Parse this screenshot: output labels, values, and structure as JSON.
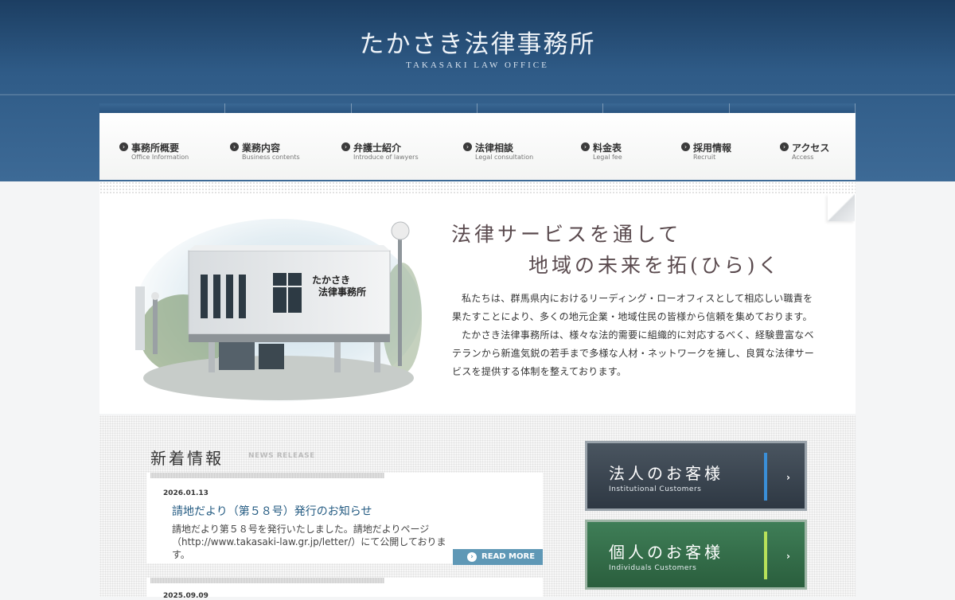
{
  "header": {
    "logo_jp": "たかさき法律事務所",
    "logo_en": "TAKASAKI LAW OFFICE"
  },
  "nav": [
    {
      "label": "事務所概要",
      "sub": "Office Information"
    },
    {
      "label": "業務内容",
      "sub": "Business contents"
    },
    {
      "label": "弁護士紹介",
      "sub": "Introduce of lawyers"
    },
    {
      "label": "法律相談",
      "sub": "Legal consultation"
    },
    {
      "label": "料金表",
      "sub": "Legal fee"
    },
    {
      "label": "採用情報",
      "sub": "Recruit"
    },
    {
      "label": "アクセス",
      "sub": "Access"
    }
  ],
  "hero": {
    "title_line1": "法律サービスを通して",
    "title_line2": "地域の未来を拓(ひら)く",
    "paragraph1": "私たちは、群馬県内におけるリーディング・ローオフィスとして相応しい職責を果たすことにより、多くの地元企業・地域住民の皆様から信頼を集めております。",
    "paragraph2": "たかさき法律事務所は、様々な法的需要に組織的に対応するべく、経験豊富なベテランから新進気鋭の若手まで多様な人材・ネットワークを擁し、良質な法律サービスを提供する体制を整えております。",
    "building_sign": [
      "たかさき",
      "法律事務所"
    ]
  },
  "news": {
    "heading": "新着情報",
    "sub": "NEWS RELEASE",
    "items": [
      {
        "date": "2026.01.13",
        "title": "請地だより（第５８号）発行のお知らせ",
        "body": "請地だより第５８号を発行いたしました。請地だよりページ（http://www.takasaki-law.gr.jp/letter/）にて公開しております。",
        "read_more": "READ MORE"
      },
      {
        "date": "2025.09.09"
      }
    ]
  },
  "customers": {
    "corporate": {
      "label": "法人のお客様",
      "sub": "Institutional Customers",
      "arrow": "›"
    },
    "individual": {
      "label": "個人のお客様",
      "sub": "Individuals Customers",
      "arrow": "›"
    }
  },
  "icons": {
    "nav_bullet": "chevron-right-circle-icon",
    "read_more": "chevron-right-circle-icon"
  },
  "colors": {
    "header": "#2f5b87",
    "link": "#245b82",
    "read_more": "#5f98b6",
    "corporate_accent": "#3a8fd8",
    "individual_accent": "#b8e25a"
  }
}
